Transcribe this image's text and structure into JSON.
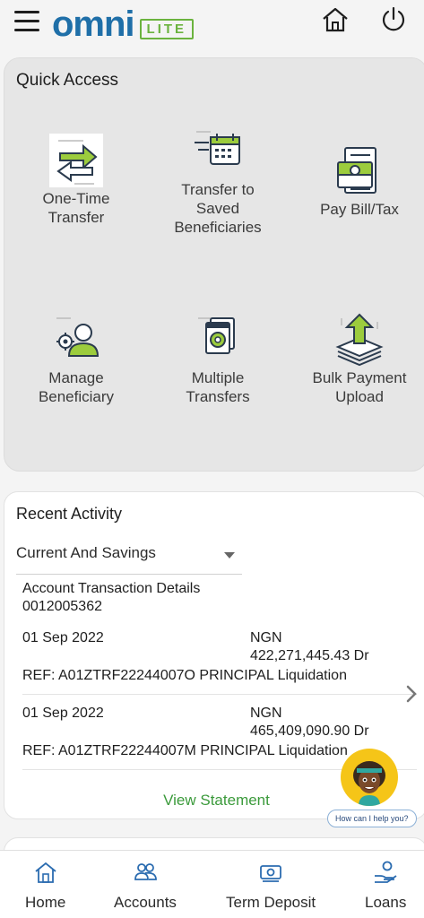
{
  "header": {
    "logo_text": "omni",
    "logo_badge": "LITE",
    "icons": [
      "menu-icon",
      "home-icon",
      "power-icon"
    ]
  },
  "quick_access": {
    "title": "Quick Access",
    "items": [
      {
        "label": "One-Time\nTransfer",
        "icon": "one-time-transfer-icon"
      },
      {
        "label": "Transfer to\nSaved\nBeneficiaries",
        "icon": "saved-beneficiaries-icon"
      },
      {
        "label": "Pay Bill/Tax",
        "icon": "pay-bill-icon"
      },
      {
        "label": "Manage\nBeneficiary",
        "icon": "manage-beneficiary-icon"
      },
      {
        "label": "Multiple\nTransfers",
        "icon": "multiple-transfers-icon"
      },
      {
        "label": "Bulk Payment\nUpload",
        "icon": "bulk-upload-icon"
      }
    ]
  },
  "recent_activity": {
    "title": "Recent Activity",
    "account_type": "Current And Savings",
    "details_heading": "Account Transaction Details",
    "account_number": "0012005362",
    "transactions": [
      {
        "date": "01 Sep 2022",
        "currency": "NGN",
        "amount": "422,271,445.43 Dr",
        "ref": "REF: A01ZTRF22244007O PRINCIPAL Liquidation"
      },
      {
        "date": "01 Sep 2022",
        "currency": "NGN",
        "amount": "465,409,090.90 Dr",
        "ref": "REF: A01ZTRF22244007M PRINCIPAL Liquidation"
      }
    ],
    "view_statement": "View Statement"
  },
  "chat": {
    "prompt": "How can I help you?"
  },
  "bottom_nav": [
    {
      "label": "Home",
      "icon": "home-icon"
    },
    {
      "label": "Accounts",
      "icon": "accounts-icon"
    },
    {
      "label": "Term Deposit",
      "icon": "term-deposit-icon"
    },
    {
      "label": "Loans",
      "icon": "loans-icon"
    }
  ],
  "colors": {
    "brand_blue": "#1f6fa8",
    "brand_green": "#6bb33e",
    "link_green": "#3b9a3b",
    "nav_icon_blue": "#2b6cb0"
  }
}
